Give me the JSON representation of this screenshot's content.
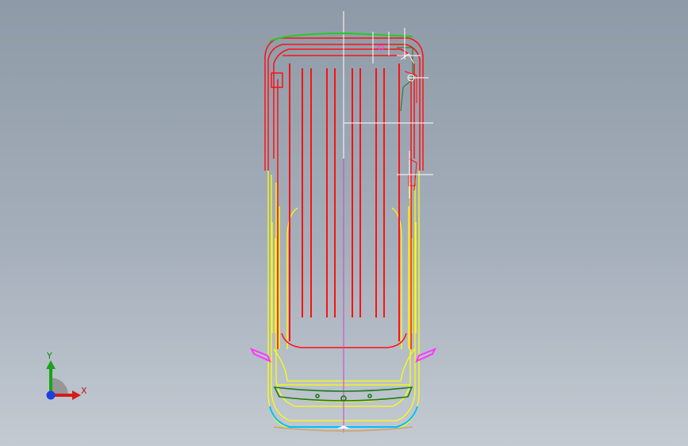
{
  "viewport": {
    "background_top": "#8e9aa7",
    "background_bottom": "#c3cad2"
  },
  "model": {
    "name": "van-wireframe-top-view",
    "colors": {
      "roof_ribs": "#ff1010",
      "body_side": "#ffff00",
      "bumper_trim": "#1a7a1a",
      "mirrors": "#ff33ff",
      "front_edge": "#00bfff",
      "highlight": "#ffffff",
      "centerline": "#cc44cc"
    }
  },
  "triad": {
    "x_label": "X",
    "y_label": "Y",
    "x_color": "#d41c1c",
    "y_color": "#1aa31a",
    "z_color": "#1c3fe0"
  }
}
